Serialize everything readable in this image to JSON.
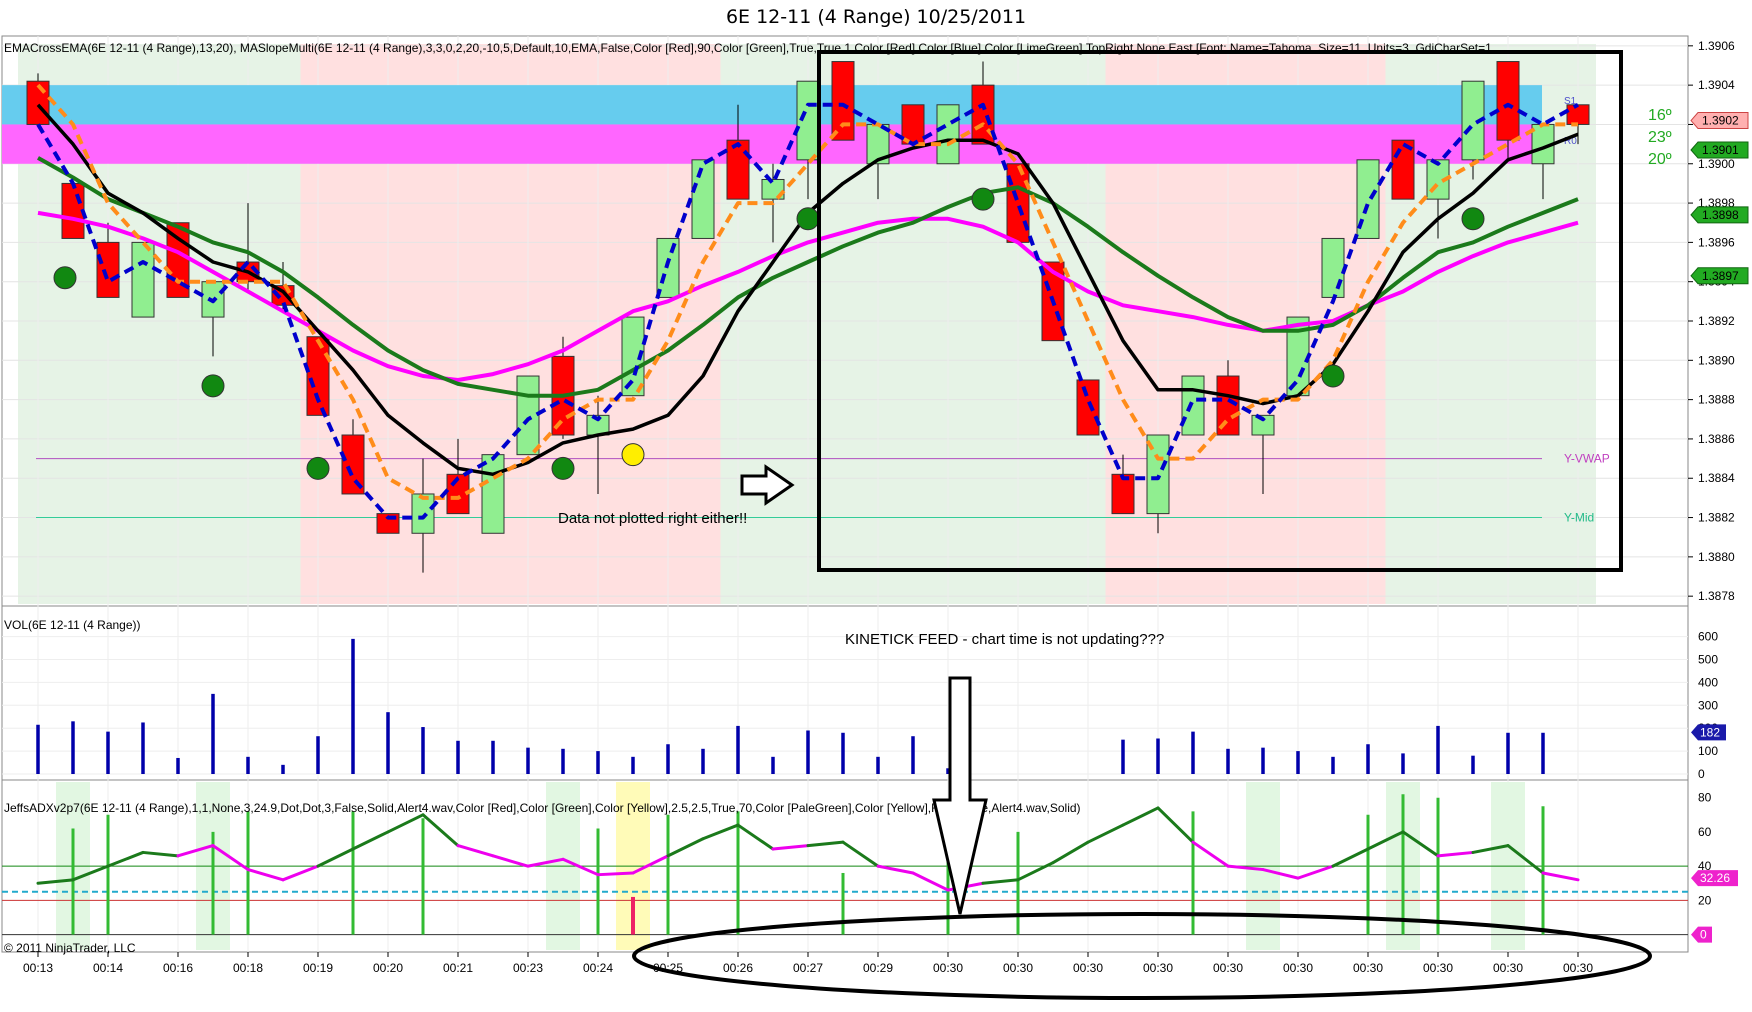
{
  "title": "6E 12-11 (4 Range)  10/25/2011",
  "colors": {
    "bull": "#90ee90",
    "bear": "#ff0000",
    "wick": "#000000",
    "black_ema": "#000000",
    "green_ema": "#1b7a1b",
    "magenta": "#ff00ff",
    "blue_dash": "#0000cc",
    "orange_dash": "#ff8c1a",
    "cyan_band": "#66ccee",
    "pink_band": "#ff66ff",
    "up_shade": "#e6f3e6",
    "down_shade": "#ffe0e0",
    "vol_bar": "#0000aa",
    "adx_bar": "#33bb33",
    "adx_green": "#1b7a1b",
    "adx_magenta": "#ee00ee",
    "dot_green": "#118811",
    "dot_yellow": "#ffee00"
  },
  "main_panel": {
    "indicator_label": "EMACrossEMA(6E  12-11  (4  Range),13,20),  MASlopeMulti(6E  12-11  (4  Range),3,3,0,2,20,-10,5,Default,10,EMA,False,Color  [Red],90,Color  [Green],True,True,1,Color  [Red],Color  [Blue],Color  [LimeGreen],TopRight,None,East,[Font:  Name=Tahoma,  Size=11,  Units=3,  GdiCharSet=1",
    "axis_labels": [
      "1.3906",
      "1.3904",
      "1.3902",
      "1.3900",
      "1.3898",
      "1.3896",
      "1.3894",
      "1.3892",
      "1.3890",
      "1.3888",
      "1.3886",
      "1.3884",
      "1.3882",
      "1.3880",
      "1.3878"
    ],
    "price_tags": [
      {
        "label": "1.3902",
        "kind": "red"
      },
      {
        "label": "1.3901",
        "kind": "green"
      },
      {
        "label": "1.3898",
        "kind": "green"
      },
      {
        "label": "1.3897",
        "kind": "green"
      }
    ],
    "angles": [
      "16º",
      "23º",
      "20º"
    ],
    "band_labels": [
      "S1",
      "R0"
    ],
    "level_labels": [
      "Y-VWAP",
      "Y-Mid"
    ],
    "annotation": "Data not plotted right either!!"
  },
  "volume_panel": {
    "label": "VOL(6E 12-11 (4 Range))",
    "annotation": "KINETICK FEED - chart time is not updating???",
    "axis_labels": [
      "600",
      "500",
      "400",
      "300",
      "200",
      "100",
      "0"
    ],
    "value_tag": "182"
  },
  "adx_panel": {
    "label": "JeffsADXv2p7(6E  12-11  (4  Range),1,1,None,3,24.9,Dot,Dot,3,False,Solid,Alert4.wav,Color  [Red],Color  [Green],Color  [Yellow],2.5,2.5,True,70,Color  [PaleGreen],Color  [Yellow],False,True,Alert4.wav,Solid)",
    "axis_labels": [
      "80",
      "60",
      "40",
      "20",
      "0"
    ],
    "value_tag": "32.26",
    "zero_tag": "0"
  },
  "copyright": "© 2011 NinjaTrader, LLC",
  "time_labels": [
    "00:13",
    "00:14",
    "00:16",
    "00:18",
    "00:19",
    "00:20",
    "00:21",
    "00:23",
    "00:24",
    "00:25",
    "00:26",
    "00:27",
    "00:29",
    "00:30",
    "00:30",
    "00:30",
    "00:30",
    "00:30",
    "00:30",
    "00:30",
    "00:30",
    "00:30",
    "00:30"
  ],
  "chart_data": {
    "type": "candlestick",
    "title": "6E 12-11 (4 Range)  10/25/2011",
    "ylim": [
      1.38775,
      1.39065
    ],
    "x_tick_labels": [
      "00:13",
      "00:14",
      "00:16",
      "00:18",
      "00:19",
      "00:20",
      "00:21",
      "00:23",
      "00:24",
      "00:25",
      "00:26",
      "00:27",
      "00:29",
      "00:30",
      "00:30",
      "00:30",
      "00:30",
      "00:30",
      "00:30",
      "00:30",
      "00:30",
      "00:30",
      "00:30"
    ],
    "candles": [
      {
        "o": 1.39042,
        "h": 1.39046,
        "l": 1.3902,
        "c": 1.3902
      },
      {
        "o": 1.3899,
        "h": 1.3899,
        "l": 1.38962,
        "c": 1.38962
      },
      {
        "o": 1.3896,
        "h": 1.3897,
        "l": 1.38932,
        "c": 1.38932
      },
      {
        "o": 1.38922,
        "h": 1.3896,
        "l": 1.38922,
        "c": 1.3896
      },
      {
        "o": 1.3897,
        "h": 1.3897,
        "l": 1.38932,
        "c": 1.38932
      },
      {
        "o": 1.38922,
        "h": 1.3894,
        "l": 1.38902,
        "c": 1.3894
      },
      {
        "o": 1.3895,
        "h": 1.3898,
        "l": 1.38935,
        "c": 1.3894
      },
      {
        "o": 1.38938,
        "h": 1.3895,
        "l": 1.38925,
        "c": 1.38928
      },
      {
        "o": 1.38912,
        "h": 1.38912,
        "l": 1.38872,
        "c": 1.38872
      },
      {
        "o": 1.38862,
        "h": 1.3887,
        "l": 1.38832,
        "c": 1.38832
      },
      {
        "o": 1.38822,
        "h": 1.38822,
        "l": 1.38812,
        "c": 1.38812
      },
      {
        "o": 1.38812,
        "h": 1.3885,
        "l": 1.38792,
        "c": 1.38832
      },
      {
        "o": 1.38842,
        "h": 1.3886,
        "l": 1.38822,
        "c": 1.38822
      },
      {
        "o": 1.38812,
        "h": 1.38852,
        "l": 1.38812,
        "c": 1.38852
      },
      {
        "o": 1.38852,
        "h": 1.38892,
        "l": 1.38852,
        "c": 1.38892
      },
      {
        "o": 1.38902,
        "h": 1.38912,
        "l": 1.3886,
        "c": 1.38862
      },
      {
        "o": 1.38862,
        "h": 1.38882,
        "l": 1.38832,
        "c": 1.38872
      },
      {
        "o": 1.38882,
        "h": 1.38922,
        "l": 1.38882,
        "c": 1.38922
      },
      {
        "o": 1.38932,
        "h": 1.38962,
        "l": 1.38932,
        "c": 1.38962
      },
      {
        "o": 1.38962,
        "h": 1.39002,
        "l": 1.38962,
        "c": 1.39002
      },
      {
        "o": 1.39012,
        "h": 1.3903,
        "l": 1.38982,
        "c": 1.38982
      },
      {
        "o": 1.38982,
        "h": 1.39,
        "l": 1.3896,
        "c": 1.38992
      },
      {
        "o": 1.39002,
        "h": 1.39042,
        "l": 1.38982,
        "c": 1.39042
      },
      {
        "o": 1.39052,
        "h": 1.39052,
        "l": 1.39012,
        "c": 1.39012
      },
      {
        "o": 1.39,
        "h": 1.3902,
        "l": 1.38982,
        "c": 1.3902
      },
      {
        "o": 1.3903,
        "h": 1.3903,
        "l": 1.3901,
        "c": 1.3901
      },
      {
        "o": 1.39,
        "h": 1.3903,
        "l": 1.39,
        "c": 1.3903
      },
      {
        "o": 1.3904,
        "h": 1.39052,
        "l": 1.3901,
        "c": 1.3901
      },
      {
        "o": 1.39,
        "h": 1.39,
        "l": 1.3896,
        "c": 1.3896
      },
      {
        "o": 1.3895,
        "h": 1.3895,
        "l": 1.3891,
        "c": 1.3891
      },
      {
        "o": 1.3889,
        "h": 1.3889,
        "l": 1.38862,
        "c": 1.38862
      },
      {
        "o": 1.38842,
        "h": 1.38852,
        "l": 1.38822,
        "c": 1.38822
      },
      {
        "o": 1.38822,
        "h": 1.38862,
        "l": 1.38812,
        "c": 1.38862
      },
      {
        "o": 1.38862,
        "h": 1.38892,
        "l": 1.38862,
        "c": 1.38892
      },
      {
        "o": 1.38892,
        "h": 1.389,
        "l": 1.38862,
        "c": 1.38862
      },
      {
        "o": 1.38862,
        "h": 1.3887,
        "l": 1.38832,
        "c": 1.38872
      },
      {
        "o": 1.38882,
        "h": 1.38922,
        "l": 1.38882,
        "c": 1.38922
      },
      {
        "o": 1.38932,
        "h": 1.38962,
        "l": 1.38932,
        "c": 1.38962
      },
      {
        "o": 1.38962,
        "h": 1.39002,
        "l": 1.38962,
        "c": 1.39002
      },
      {
        "o": 1.39012,
        "h": 1.39012,
        "l": 1.38982,
        "c": 1.38982
      },
      {
        "o": 1.38982,
        "h": 1.39002,
        "l": 1.38962,
        "c": 1.39002
      },
      {
        "o": 1.39002,
        "h": 1.39042,
        "l": 1.38992,
        "c": 1.39042
      },
      {
        "o": 1.39052,
        "h": 1.39052,
        "l": 1.39002,
        "c": 1.39012
      },
      {
        "o": 1.39,
        "h": 1.3902,
        "l": 1.38982,
        "c": 1.3902
      },
      {
        "o": 1.3903,
        "h": 1.3903,
        "l": 1.3901,
        "c": 1.3902
      }
    ],
    "series": [
      {
        "kind": "black_ema",
        "values": [
          1.3903,
          1.3901,
          1.38985,
          1.38975,
          1.38962,
          1.3895,
          1.38945,
          1.38935,
          1.38915,
          1.38895,
          1.38872,
          1.38858,
          1.38845,
          1.38842,
          1.38848,
          1.38858,
          1.38862,
          1.38865,
          1.38872,
          1.38892,
          1.38925,
          1.3895,
          1.38975,
          1.3899,
          1.39002,
          1.39008,
          1.39012,
          1.39012,
          1.39005,
          1.3898,
          1.38945,
          1.3891,
          1.38885,
          1.38885,
          1.38882,
          1.38878,
          1.38882,
          1.38898,
          1.38925,
          1.38955,
          1.38972,
          1.38985,
          1.39002,
          1.39008,
          1.39015
        ]
      },
      {
        "kind": "green_ema",
        "values": [
          1.39003,
          1.38993,
          1.38982,
          1.38975,
          1.38968,
          1.3896,
          1.38955,
          1.38945,
          1.38932,
          1.38918,
          1.38905,
          1.38895,
          1.38888,
          1.38885,
          1.38882,
          1.38882,
          1.38885,
          1.38895,
          1.38905,
          1.38918,
          1.38932,
          1.38942,
          1.3895,
          1.38958,
          1.38965,
          1.3897,
          1.38978,
          1.38985,
          1.38988,
          1.3898,
          1.38968,
          1.38955,
          1.38943,
          1.38932,
          1.38922,
          1.38915,
          1.38915,
          1.38918,
          1.38928,
          1.38942,
          1.38955,
          1.3896,
          1.38968,
          1.38975,
          1.38982
        ]
      },
      {
        "kind": "magenta",
        "values": [
          1.38975,
          1.38972,
          1.38968,
          1.38962,
          1.38955,
          1.38945,
          1.38935,
          1.38925,
          1.38915,
          1.38905,
          1.38897,
          1.38892,
          1.3889,
          1.38893,
          1.38898,
          1.38905,
          1.38915,
          1.38925,
          1.3893,
          1.38938,
          1.38945,
          1.38953,
          1.3896,
          1.38965,
          1.3897,
          1.38972,
          1.38972,
          1.38968,
          1.3896,
          1.38945,
          1.38935,
          1.38928,
          1.38925,
          1.38922,
          1.38918,
          1.38915,
          1.38918,
          1.3892,
          1.38928,
          1.38935,
          1.38945,
          1.38953,
          1.3896,
          1.38965,
          1.3897
        ]
      },
      {
        "kind": "blue_dash",
        "values": [
          1.3902,
          1.3899,
          1.3894,
          1.3895,
          1.3894,
          1.3893,
          1.3895,
          1.3893,
          1.3888,
          1.3884,
          1.3882,
          1.3882,
          1.3884,
          1.3885,
          1.3887,
          1.3888,
          1.3887,
          1.3889,
          1.3895,
          1.39,
          1.3901,
          1.3899,
          1.3903,
          1.3903,
          1.3902,
          1.3901,
          1.3902,
          1.3903,
          1.3898,
          1.3893,
          1.3888,
          1.3884,
          1.3884,
          1.3888,
          1.3888,
          1.3887,
          1.3889,
          1.3893,
          1.3898,
          1.3901,
          1.39,
          1.3902,
          1.3903,
          1.3902,
          1.3903
        ]
      },
      {
        "kind": "orange_dash",
        "values": [
          1.3904,
          1.3902,
          1.3898,
          1.3896,
          1.3894,
          1.3894,
          1.3894,
          1.3894,
          1.3891,
          1.3888,
          1.3884,
          1.3883,
          1.3883,
          1.3884,
          1.3885,
          1.3887,
          1.3888,
          1.3888,
          1.3891,
          1.3895,
          1.3898,
          1.3898,
          1.39,
          1.3902,
          1.3902,
          1.3901,
          1.3901,
          1.3902,
          1.39,
          1.3896,
          1.3892,
          1.3888,
          1.3885,
          1.3885,
          1.3887,
          1.3888,
          1.3888,
          1.389,
          1.3894,
          1.3897,
          1.3899,
          1.39,
          1.3901,
          1.3902,
          1.3902
        ]
      }
    ],
    "dots": [
      {
        "i": 1,
        "y": 1.38942,
        "kind": "green"
      },
      {
        "i": 5,
        "y": 1.38887,
        "kind": "green"
      },
      {
        "i": 8,
        "y": 1.38845,
        "kind": "green"
      },
      {
        "i": 15,
        "y": 1.38845,
        "kind": "green"
      },
      {
        "i": 17,
        "y": 1.38852,
        "kind": "yellow"
      },
      {
        "i": 22,
        "y": 1.38972,
        "kind": "green"
      },
      {
        "i": 27,
        "y": 1.38982,
        "kind": "green"
      },
      {
        "i": 37,
        "y": 1.38892,
        "kind": "green"
      },
      {
        "i": 41,
        "y": 1.38972,
        "kind": "green"
      }
    ],
    "bands": [
      {
        "y0": 1.3902,
        "y1": 1.3904,
        "kind": "cyan"
      },
      {
        "y0": 1.39,
        "y1": 1.3902,
        "kind": "pink"
      }
    ],
    "levels": [
      {
        "y": 1.3885,
        "name": "Y-VWAP"
      },
      {
        "y": 1.3882,
        "name": "Y-Mid"
      }
    ],
    "shading": [
      {
        "from": 0,
        "to": 8,
        "kind": "up"
      },
      {
        "from": 8,
        "to": 20,
        "kind": "down"
      },
      {
        "from": 20,
        "to": 31,
        "kind": "up"
      },
      {
        "from": 31,
        "to": 39,
        "kind": "down"
      },
      {
        "from": 39,
        "to": 45,
        "kind": "up"
      }
    ],
    "volume": {
      "ylim": [
        0,
        620
      ],
      "values": [
        215,
        230,
        185,
        225,
        70,
        350,
        75,
        40,
        165,
        590,
        270,
        205,
        145,
        145,
        115,
        110,
        100,
        75,
        130,
        110,
        210,
        75,
        190,
        180,
        75,
        165,
        25,
        0,
        0,
        0,
        0,
        150,
        155,
        185,
        110,
        115,
        100,
        75,
        130,
        90,
        210,
        80,
        180,
        180,
        0
      ]
    },
    "adx": {
      "ylim": [
        -2,
        88
      ],
      "bars": [
        0,
        62,
        70,
        0,
        0,
        60,
        72,
        0,
        0,
        72,
        0,
        68,
        0,
        0,
        0,
        0,
        62,
        0,
        70,
        0,
        72,
        0,
        0,
        36,
        0,
        0,
        72,
        0,
        60,
        0,
        0,
        0,
        0,
        72,
        0,
        0,
        0,
        0,
        70,
        82,
        80,
        0,
        0,
        75,
        0
      ],
      "red_bars": [
        0,
        0,
        0,
        0,
        0,
        0,
        0,
        0,
        0,
        0,
        0,
        0,
        0,
        0,
        0,
        0,
        0,
        22,
        0,
        0,
        0,
        0,
        0,
        0,
        0,
        0,
        0,
        0,
        0,
        0,
        0,
        0,
        0,
        0,
        0,
        0,
        0,
        0,
        0,
        0,
        0,
        0,
        0,
        0,
        0
      ],
      "line": [
        30,
        32,
        40,
        48,
        46,
        52,
        38,
        32,
        40,
        50,
        60,
        70,
        52,
        46,
        40,
        44,
        35,
        36,
        46,
        56,
        64,
        50,
        52,
        54,
        40,
        36,
        26,
        30,
        32,
        42,
        54,
        64,
        74,
        54,
        40,
        38,
        33,
        40,
        50,
        60,
        46,
        48,
        52,
        36,
        32
      ],
      "line_trend": [
        1,
        1,
        1,
        1,
        0,
        0,
        0,
        0,
        1,
        1,
        1,
        1,
        0,
        0,
        0,
        0,
        0,
        0,
        1,
        1,
        1,
        0,
        1,
        1,
        0,
        0,
        0,
        1,
        1,
        1,
        1,
        1,
        1,
        0,
        0,
        0,
        0,
        1,
        1,
        1,
        0,
        1,
        1,
        0,
        0
      ],
      "pale_zones": [
        1,
        5,
        15,
        35,
        39,
        42
      ],
      "yellow_zones": [
        17
      ],
      "level_lines": [
        20,
        25,
        40
      ]
    }
  }
}
